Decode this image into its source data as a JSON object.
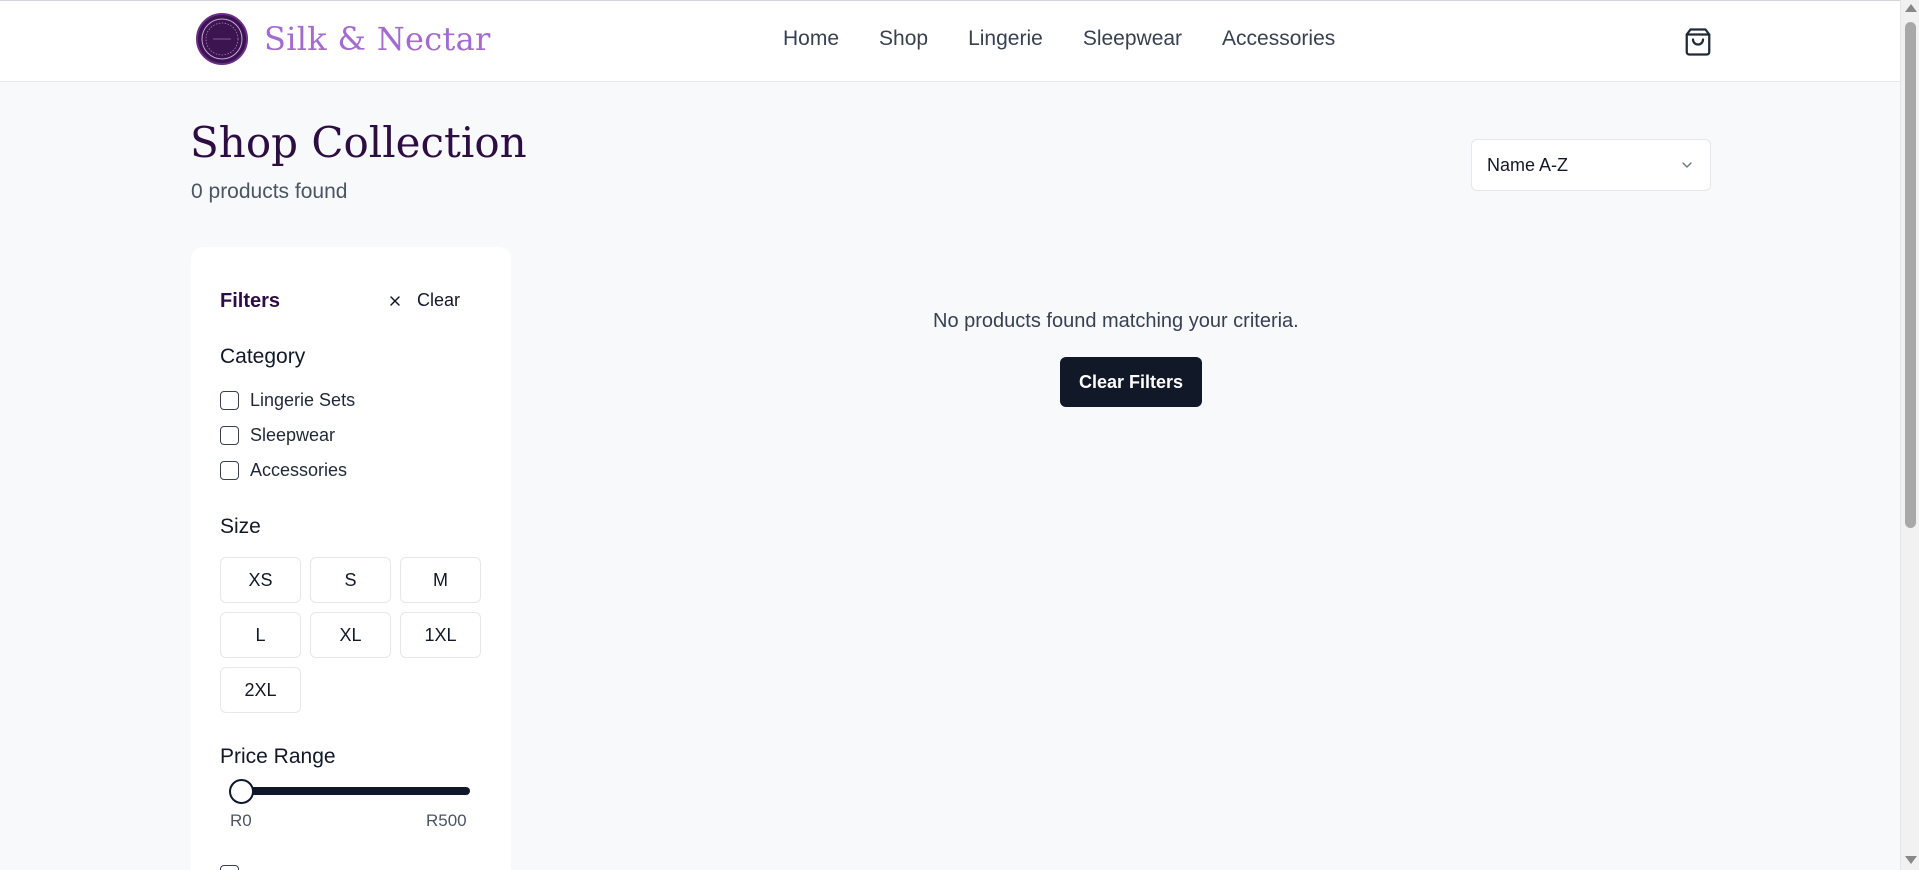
{
  "brand": {
    "name": "Silk & Nectar",
    "logo_text": "SILK & NECTAR"
  },
  "nav": {
    "items": [
      "Home",
      "Shop",
      "Lingerie",
      "Sleepwear",
      "Accessories"
    ]
  },
  "page": {
    "title": "Shop Collection",
    "count": "0 products found"
  },
  "sort": {
    "selected": "Name A-Z"
  },
  "filters": {
    "title": "Filters",
    "clear_label": "Clear",
    "category": {
      "title": "Category",
      "options": [
        "Lingerie Sets",
        "Sleepwear",
        "Accessories"
      ]
    },
    "size": {
      "title": "Size",
      "options": [
        "XS",
        "S",
        "M",
        "L",
        "XL",
        "1XL",
        "2XL"
      ]
    },
    "price": {
      "title": "Price Range",
      "min_label": "R0",
      "max_label": "R500",
      "value": 0
    }
  },
  "results": {
    "empty_message": "No products found matching your criteria.",
    "clear_button": "Clear Filters"
  },
  "colors": {
    "brand": "#a36ad1",
    "heading": "#2d0e42",
    "button": "#111827"
  },
  "icons": {
    "cart": "shopping-bag-icon",
    "clear": "close-icon",
    "sort": "chevron-down-icon"
  }
}
